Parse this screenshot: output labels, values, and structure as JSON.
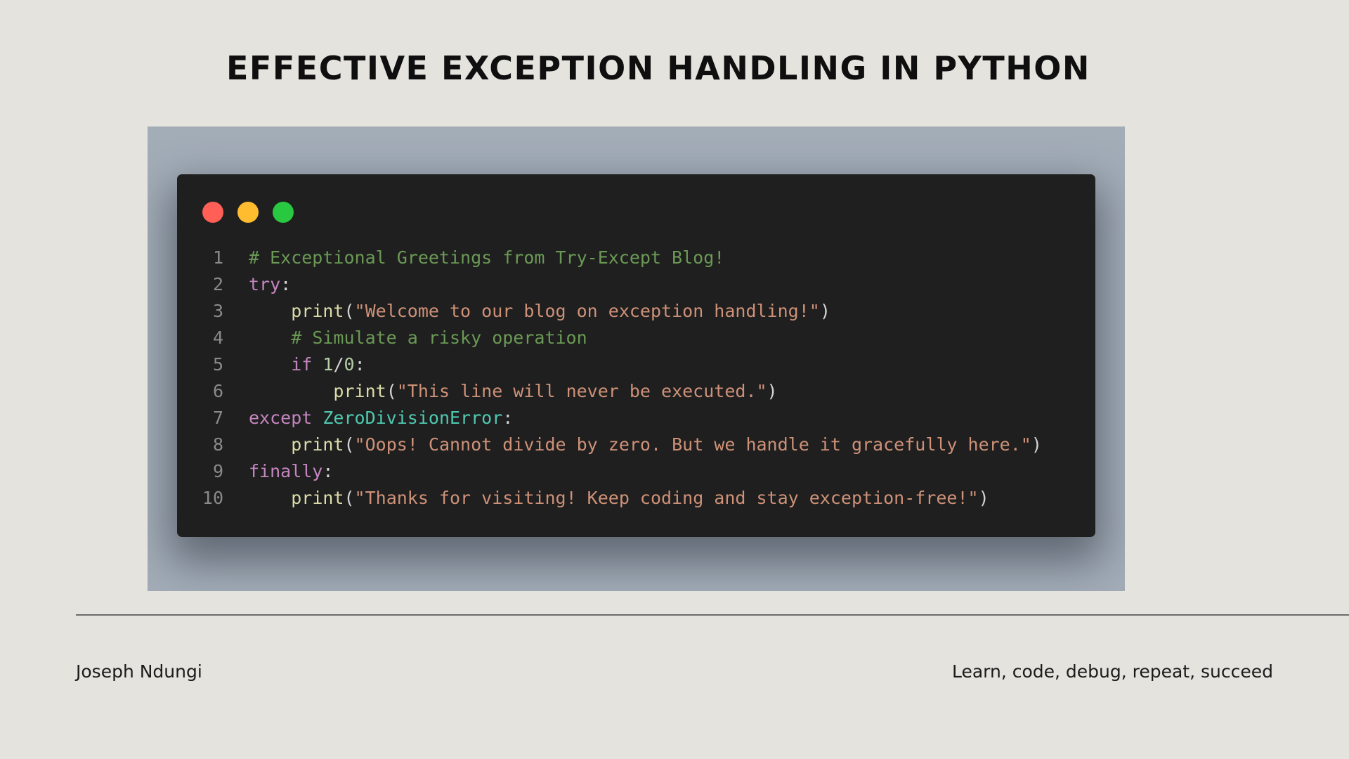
{
  "slide": {
    "title": "EFFECTIVE EXCEPTION HANDLING IN PYTHON"
  },
  "window": {
    "controls": [
      {
        "name": "close",
        "color": "#ff5f57"
      },
      {
        "name": "minimize",
        "color": "#febc2e"
      },
      {
        "name": "maximize",
        "color": "#28c840"
      }
    ]
  },
  "code": {
    "lines": [
      {
        "num": "1",
        "indent": "",
        "tokens": [
          {
            "t": "# Exceptional Greetings from Try-Except Blog!",
            "c": "comment"
          }
        ]
      },
      {
        "num": "2",
        "indent": "",
        "tokens": [
          {
            "t": "try",
            "c": "keyword"
          },
          {
            "t": ":",
            "c": "punct"
          }
        ]
      },
      {
        "num": "3",
        "indent": "    ",
        "tokens": [
          {
            "t": "print",
            "c": "builtin"
          },
          {
            "t": "(",
            "c": "punct"
          },
          {
            "t": "\"Welcome to our blog on exception handling!\"",
            "c": "string"
          },
          {
            "t": ")",
            "c": "punct"
          }
        ]
      },
      {
        "num": "4",
        "indent": "    ",
        "tokens": [
          {
            "t": "# Simulate a risky operation",
            "c": "comment"
          }
        ]
      },
      {
        "num": "5",
        "indent": "    ",
        "tokens": [
          {
            "t": "if",
            "c": "keyword"
          },
          {
            "t": " ",
            "c": "punct"
          },
          {
            "t": "1",
            "c": "number"
          },
          {
            "t": "/",
            "c": "punct"
          },
          {
            "t": "0",
            "c": "number"
          },
          {
            "t": ":",
            "c": "punct"
          }
        ]
      },
      {
        "num": "6",
        "indent": "        ",
        "tokens": [
          {
            "t": "print",
            "c": "builtin"
          },
          {
            "t": "(",
            "c": "punct"
          },
          {
            "t": "\"This line will never be executed.\"",
            "c": "string"
          },
          {
            "t": ")",
            "c": "punct"
          }
        ]
      },
      {
        "num": "7",
        "indent": "",
        "tokens": [
          {
            "t": "except",
            "c": "keyword"
          },
          {
            "t": " ",
            "c": "punct"
          },
          {
            "t": "ZeroDivisionError",
            "c": "classname"
          },
          {
            "t": ":",
            "c": "punct"
          }
        ]
      },
      {
        "num": "8",
        "indent": "    ",
        "tokens": [
          {
            "t": "print",
            "c": "builtin"
          },
          {
            "t": "(",
            "c": "punct"
          },
          {
            "t": "\"Oops! Cannot divide by zero. But we handle it gracefully here.\"",
            "c": "string"
          },
          {
            "t": ")",
            "c": "punct"
          }
        ]
      },
      {
        "num": "9",
        "indent": "",
        "tokens": [
          {
            "t": "finally",
            "c": "keyword"
          },
          {
            "t": ":",
            "c": "punct"
          }
        ]
      },
      {
        "num": "10",
        "indent": "    ",
        "tokens": [
          {
            "t": "print",
            "c": "builtin"
          },
          {
            "t": "(",
            "c": "punct"
          },
          {
            "t": "\"Thanks for visiting! Keep coding and stay exception-free!\"",
            "c": "string"
          },
          {
            "t": ")",
            "c": "punct"
          }
        ]
      }
    ]
  },
  "footer": {
    "author": "Joseph Ndungi",
    "tagline": "Learn, code, debug, repeat, succeed"
  }
}
